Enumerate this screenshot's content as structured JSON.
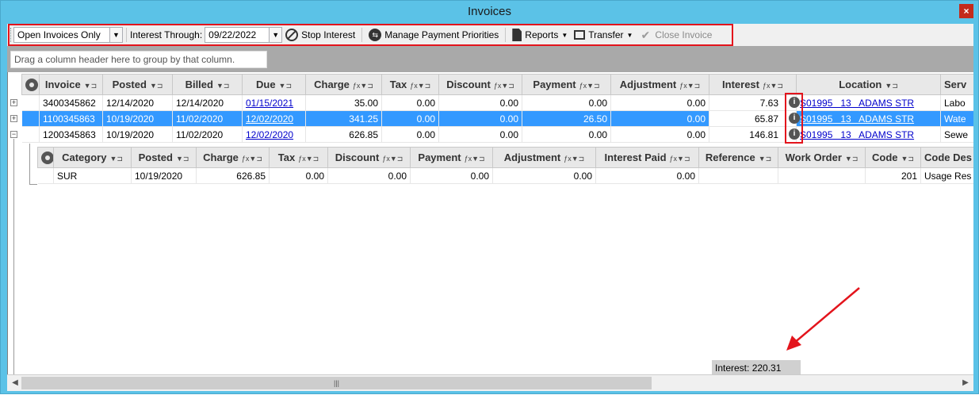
{
  "window": {
    "title": "Invoices",
    "close_label": "×"
  },
  "toolbar": {
    "filter_value": "Open Invoices Only",
    "interest_label": "Interest Through:",
    "interest_date": "09/22/2022",
    "stop_interest": "Stop Interest",
    "manage_priorities": "Manage Payment Priorities",
    "reports": "Reports",
    "transfer": "Transfer",
    "close_invoice": "Close Invoice"
  },
  "group_hint": "Drag a column header here to group by that column.",
  "invoice_grid": {
    "columns": [
      "Invoice",
      "Posted",
      "Billed",
      "Due",
      "Charge",
      "Tax",
      "Discount",
      "Payment",
      "Adjustment",
      "Interest",
      "Location",
      "Serv"
    ],
    "rows": [
      {
        "invoice": "3400345862",
        "posted": "12/14/2020",
        "billed": "12/14/2020",
        "due": "01/15/2021",
        "charge": "35.00",
        "tax": "0.00",
        "discount": "0.00",
        "payment": "0.00",
        "adjustment": "0.00",
        "interest": "7.63",
        "location": "S01995   13   ADAMS STR",
        "service": "Labo"
      },
      {
        "invoice": "1100345863",
        "posted": "10/19/2020",
        "billed": "11/02/2020",
        "due": "12/02/2020",
        "charge": "341.25",
        "tax": "0.00",
        "discount": "0.00",
        "payment": "26.50",
        "adjustment": "0.00",
        "interest": "65.87",
        "location": "S01995   13   ADAMS STR",
        "service": "Wate"
      },
      {
        "invoice": "1200345863",
        "posted": "10/19/2020",
        "billed": "11/02/2020",
        "due": "12/02/2020",
        "charge": "626.85",
        "tax": "0.00",
        "discount": "0.00",
        "payment": "0.00",
        "adjustment": "0.00",
        "interest": "146.81",
        "location": "S01995   13   ADAMS STR",
        "service": "Sewe"
      }
    ]
  },
  "detail_grid": {
    "columns": [
      "Category",
      "Posted",
      "Charge",
      "Tax",
      "Discount",
      "Payment",
      "Adjustment",
      "Interest Paid",
      "Reference",
      "Work Order",
      "Code",
      "Code Des"
    ],
    "rows": [
      {
        "category": "SUR",
        "posted": "10/19/2020",
        "charge": "626.85",
        "tax": "0.00",
        "discount": "0.00",
        "payment": "0.00",
        "adjustment": "0.00",
        "interest_paid": "0.00",
        "reference": "",
        "work_order": "",
        "code": "201",
        "code_desc": "Usage Res"
      }
    ]
  },
  "summary": {
    "interest_total": "Interest: 220.31"
  },
  "colors": {
    "accent": "#5bc2e7",
    "selection": "#3399ff",
    "highlight": "#e3141c"
  }
}
